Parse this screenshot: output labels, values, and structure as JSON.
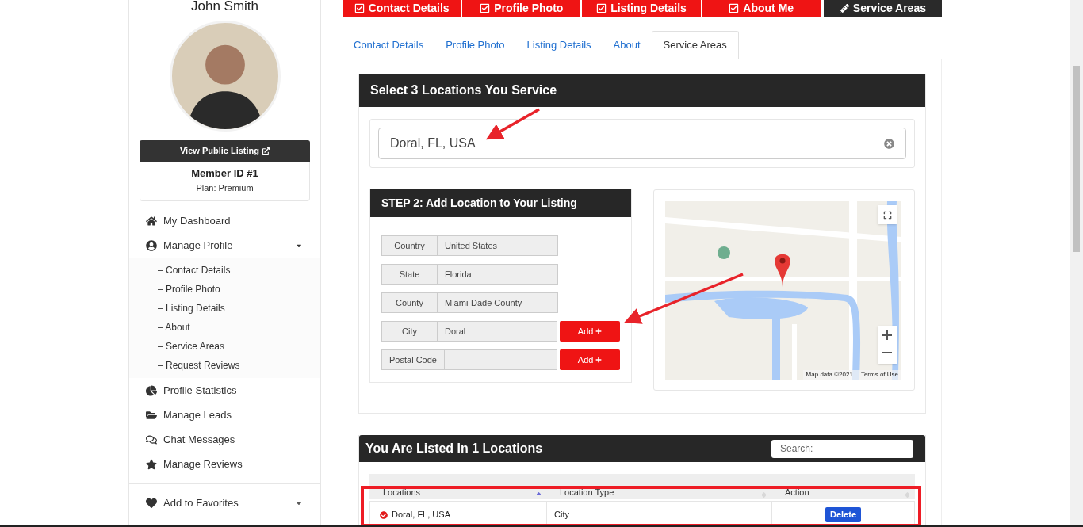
{
  "sidebar": {
    "name": "John Smith",
    "view_listing_button": "View Public Listing",
    "member_id": "Member ID #1",
    "plan": "Plan: Premium",
    "nav": [
      {
        "label": "My Dashboard"
      },
      {
        "label": "Manage Profile",
        "expanded": true,
        "children": [
          {
            "label": "– Contact Details"
          },
          {
            "label": "– Profile Photo"
          },
          {
            "label": "– Listing Details"
          },
          {
            "label": "– About"
          },
          {
            "label": "– Service Areas"
          },
          {
            "label": "– Request Reviews"
          }
        ]
      },
      {
        "label": "Profile Statistics"
      },
      {
        "label": "Manage Leads"
      },
      {
        "label": "Chat Messages"
      },
      {
        "label": "Manage Reviews"
      }
    ],
    "nav_2": [
      {
        "label": "Add to Favorites",
        "expanded": false
      }
    ]
  },
  "step_buttons": [
    {
      "label": "Contact Details",
      "selected": false
    },
    {
      "label": "Profile Photo",
      "selected": false
    },
    {
      "label": "Listing Details",
      "selected": false
    },
    {
      "label": "About Me",
      "selected": false
    },
    {
      "label": "Service Areas",
      "selected": true
    }
  ],
  "tabs": [
    {
      "label": "Contact Details",
      "selected": false
    },
    {
      "label": "Profile Photo",
      "selected": false
    },
    {
      "label": "Listing Details",
      "selected": false
    },
    {
      "label": "About",
      "selected": false
    },
    {
      "label": "Service Areas",
      "selected": true
    }
  ],
  "locations_panel": {
    "title": "Select 3 Locations You Service",
    "search_value": "Doral, FL, USA"
  },
  "step2": {
    "title": "STEP 2: Add Location to Your Listing",
    "fields": [
      {
        "label": "Country",
        "value": "United States"
      },
      {
        "label": "State",
        "value": "Florida"
      },
      {
        "label": "County",
        "value": "Miami-Dade County"
      },
      {
        "label": "City",
        "value": "Doral",
        "button": "Add"
      },
      {
        "label": "Postal Code",
        "button": "Add"
      }
    ]
  },
  "map": {
    "attribution": "Map data ©2021",
    "terms": "Terms of Use"
  },
  "listed": {
    "title": "You Are Listed In 1 Locations",
    "search_placeholder": "Search:",
    "columns": [
      {
        "label": "Locations",
        "sorted": true
      },
      {
        "label": "Location Type",
        "sorted": false
      },
      {
        "label": "Action",
        "sorted": false
      }
    ],
    "rows": [
      {
        "location": "Doral, FL, USA",
        "type": "City",
        "action": "Delete"
      }
    ]
  }
}
